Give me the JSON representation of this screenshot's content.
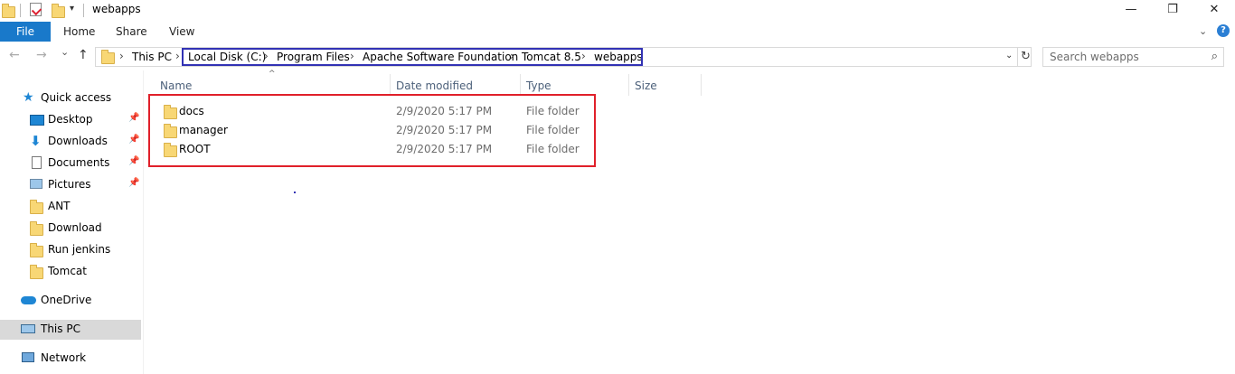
{
  "window": {
    "title": "webapps",
    "minimize_glyph": "—",
    "restore_glyph": "❐",
    "close_glyph": "✕",
    "qat_dropdown_glyph": "▾"
  },
  "ribbon": {
    "tabs": [
      "File",
      "Home",
      "Share",
      "View"
    ],
    "expand_glyph": "⌄",
    "help_glyph": "?"
  },
  "nav": {
    "back_glyph": "←",
    "forward_glyph": "→",
    "recent_glyph": "⌄",
    "up_glyph": "↑",
    "breadcrumb": [
      "This PC",
      "Local Disk (C:)",
      "Program Files",
      "Apache Software Foundation",
      "Tomcat 8.5",
      "webapps"
    ],
    "separator": "›",
    "dropdown_glyph": "⌄",
    "refresh_glyph": "↻"
  },
  "search": {
    "placeholder": "Search webapps",
    "icon": "search-icon",
    "icon_glyph": "⌕"
  },
  "sidebar": {
    "pin_glyph": "📌",
    "items": [
      {
        "label": "Quick access",
        "icon": "star-icon"
      },
      {
        "label": "Desktop",
        "icon": "desktop-icon",
        "pinned": true
      },
      {
        "label": "Downloads",
        "icon": "download-icon",
        "pinned": true
      },
      {
        "label": "Documents",
        "icon": "documents-icon",
        "pinned": true
      },
      {
        "label": "Pictures",
        "icon": "pictures-icon",
        "pinned": true
      },
      {
        "label": "ANT",
        "icon": "folder-icon"
      },
      {
        "label": "Download",
        "icon": "folder-icon"
      },
      {
        "label": "Run jenkins",
        "icon": "folder-icon"
      },
      {
        "label": "Tomcat",
        "icon": "folder-icon"
      },
      {
        "label": "OneDrive",
        "icon": "cloud-icon"
      },
      {
        "label": "This PC",
        "icon": "computer-icon",
        "selected": true
      },
      {
        "label": "Network",
        "icon": "network-icon"
      }
    ]
  },
  "columns": {
    "sort_glyph": "^",
    "name": "Name",
    "date_modified": "Date modified",
    "type": "Type",
    "size": "Size"
  },
  "files": [
    {
      "name": "docs",
      "date": "2/9/2020 5:17 PM",
      "type": "File folder"
    },
    {
      "name": "manager",
      "date": "2/9/2020 5:17 PM",
      "type": "File folder"
    },
    {
      "name": "ROOT",
      "date": "2/9/2020 5:17 PM",
      "type": "File folder"
    }
  ],
  "colors": {
    "accent": "#1979ca",
    "address_highlight": "#3232b4",
    "files_highlight": "#e0202a",
    "folder": "#f8d775",
    "selected_bg": "#d9d9d9"
  }
}
